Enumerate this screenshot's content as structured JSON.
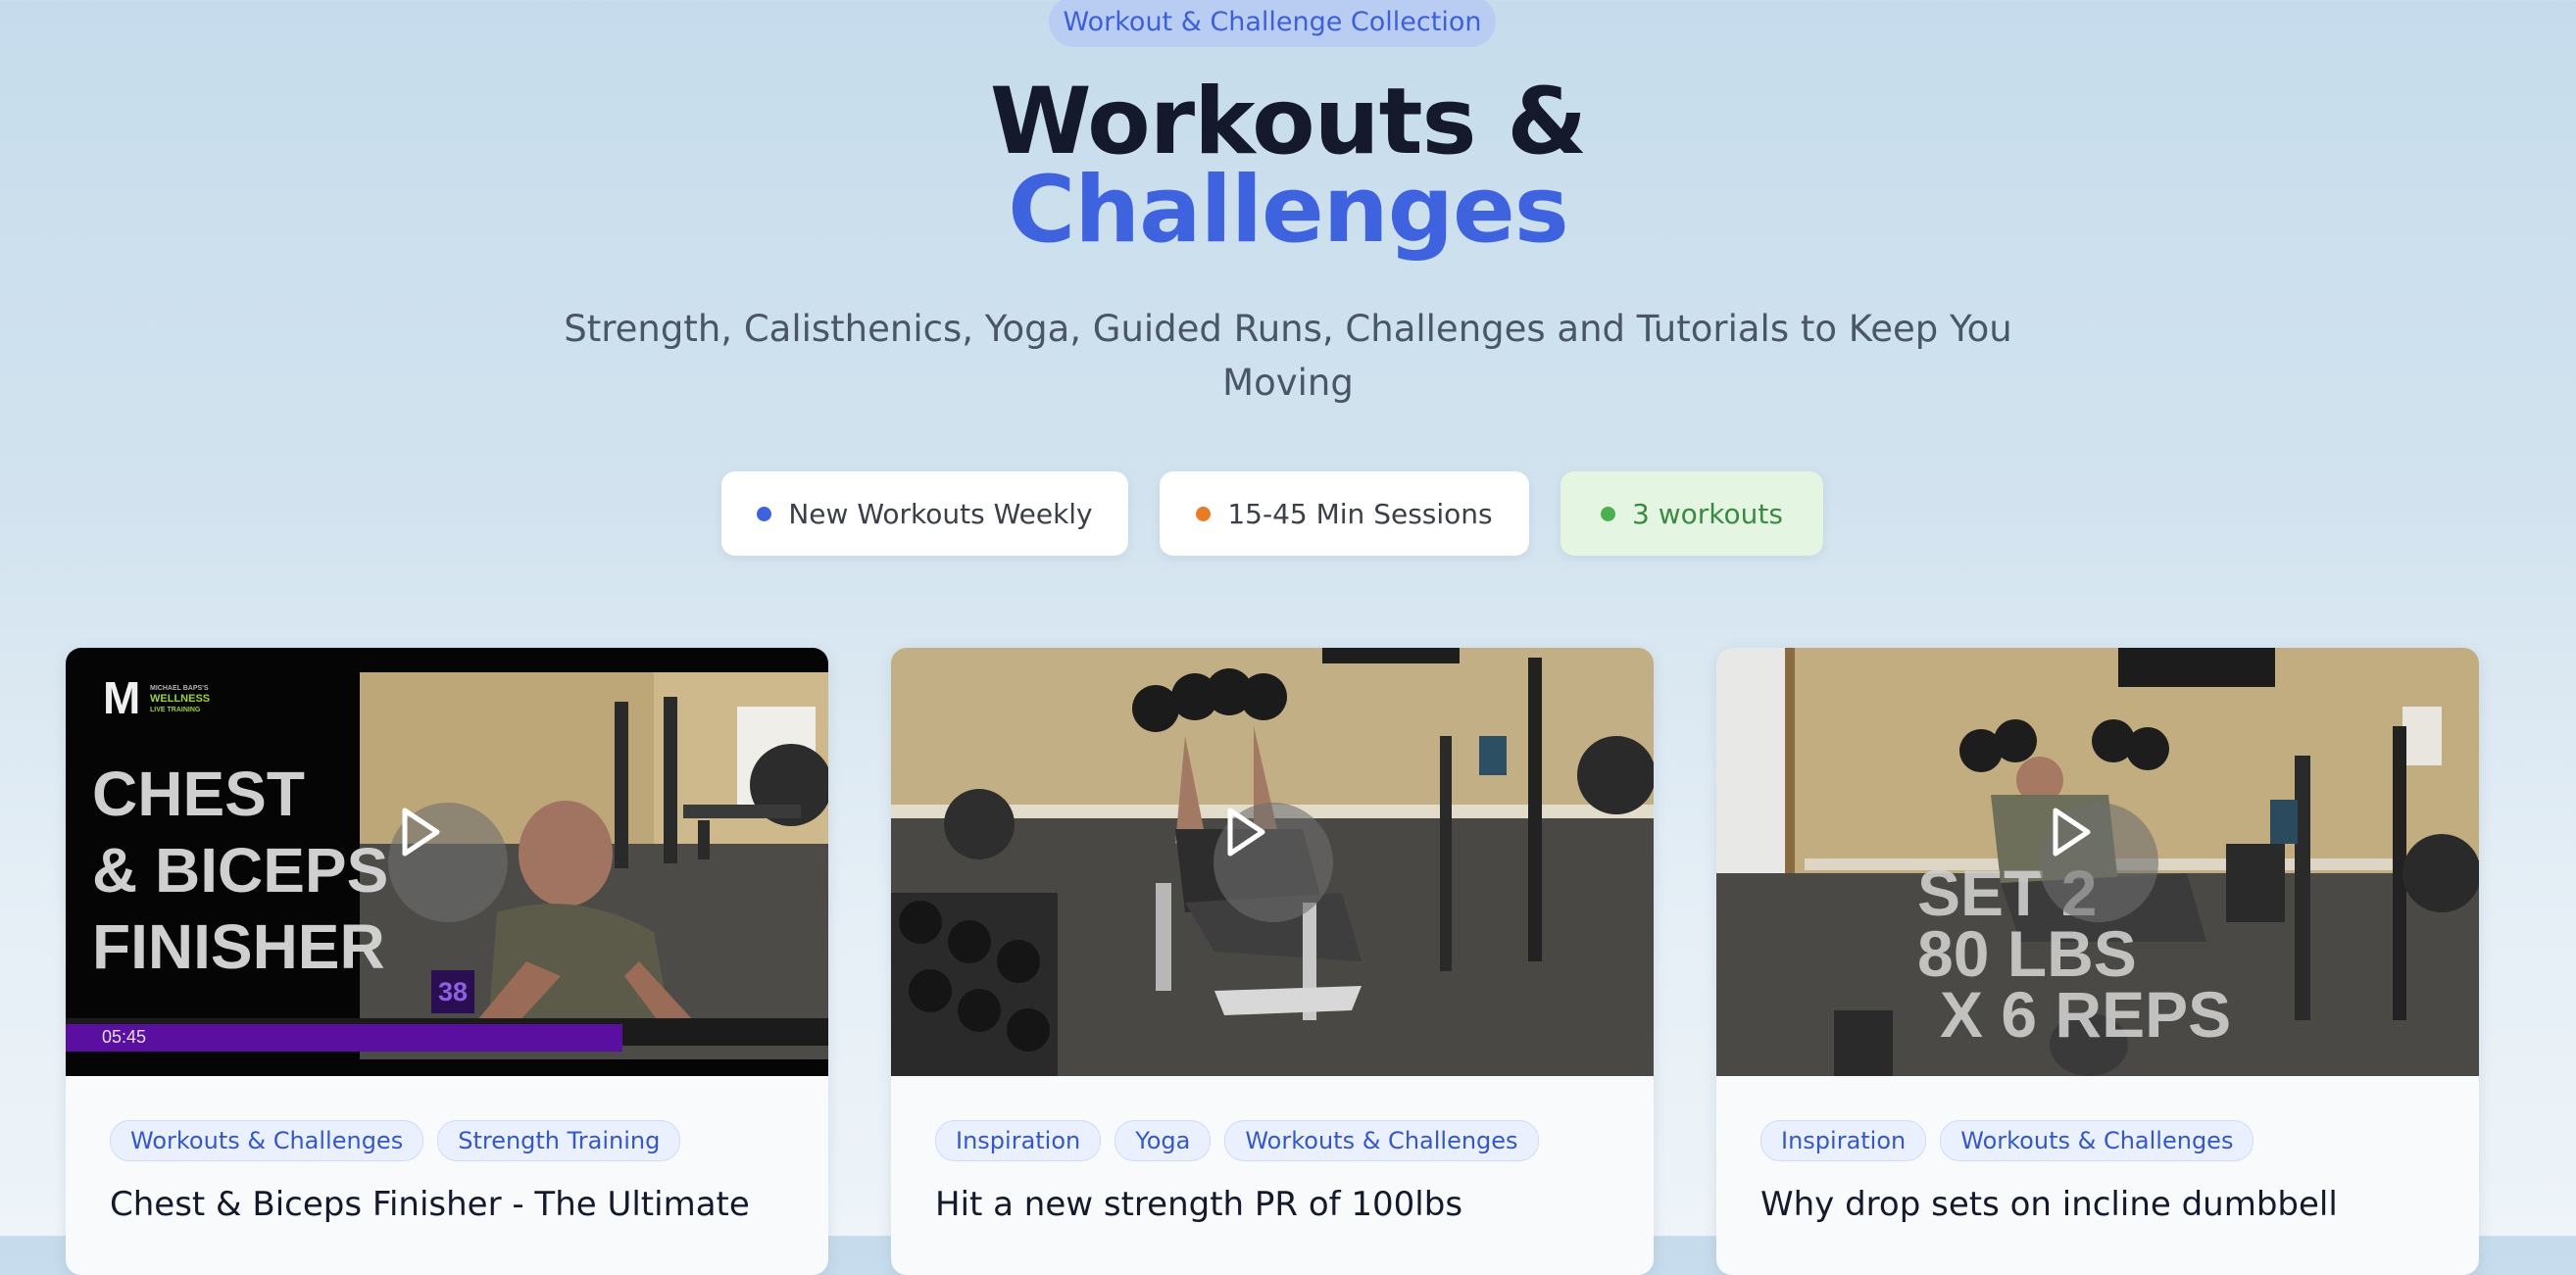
{
  "header": {
    "eyebrow": "Workout & Challenge Collection",
    "title_line1": "Workouts &",
    "title_line2": "Challenges",
    "subtitle": "Strength, Calisthenics, Yoga, Guided Runs, Challenges and Tutorials to Keep You Moving"
  },
  "pills": [
    {
      "label": "New Workouts Weekly",
      "dot_color": "#3f63de"
    },
    {
      "label": "15-45 Min Sessions",
      "dot_color": "#e87b23"
    },
    {
      "label": "3 workouts",
      "dot_color": "#4caf50"
    }
  ],
  "cards": [
    {
      "tags": [
        "Workouts & Challenges",
        "Strength Training"
      ],
      "title": "Chest & Biceps Finisher - The Ultimate",
      "overlay": {
        "logo_letter": "M",
        "logo_line1": "MICHAEL BAPS'S",
        "logo_line2": "WELLNESS",
        "logo_line3": "LIVE TRAINING",
        "line1": "CHEST",
        "line2": "& BICEPS",
        "line3": "FINISHER",
        "counter": "38",
        "timestamp": "05:45",
        "progress": 0.73
      }
    },
    {
      "tags": [
        "Inspiration",
        "Yoga",
        "Workouts & Challenges"
      ],
      "title": "Hit a new strength PR of 100lbs"
    },
    {
      "tags": [
        "Inspiration",
        "Workouts & Challenges"
      ],
      "title": "Why drop sets on incline dumbbell",
      "overlay": {
        "line1": "SET 2",
        "line2": "80 LBS",
        "line3": "X 6 REPS"
      }
    }
  ],
  "colors": {
    "accent": "#3f63de",
    "title_dark": "#141a2b",
    "tag_text": "#3558c9",
    "progress_purple": "#5a0fa0"
  }
}
